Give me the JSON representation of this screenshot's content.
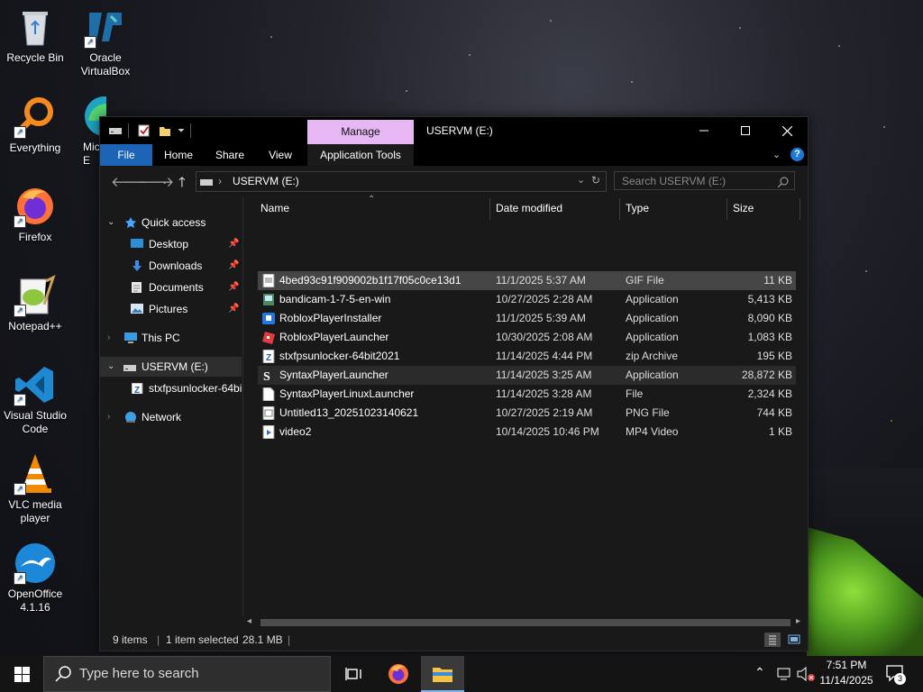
{
  "desktop": {
    "icons": [
      {
        "label": "Recycle Bin"
      },
      {
        "label": "Oracle VirtualBox"
      },
      {
        "label": "Everything"
      },
      {
        "label": "Firefox"
      },
      {
        "label": "Notepad++"
      },
      {
        "label": "Visual Studio Code"
      },
      {
        "label": "VLC media player"
      },
      {
        "label": "OpenOffice 4.1.16"
      },
      {
        "label": "Microsoft Edge (partially hidden)",
        "visible_text": "Mic E"
      }
    ]
  },
  "explorer": {
    "title": "USERVM (E:)",
    "manage_tab": "Manage",
    "ribbon_tabs": {
      "file": "File",
      "home": "Home",
      "share": "Share",
      "view": "View",
      "app_tools": "Application Tools"
    },
    "address": "USERVM (E:)",
    "search_placeholder": "Search USERVM (E:)",
    "nav": {
      "quick_access": "Quick access",
      "desktop": "Desktop",
      "downloads": "Downloads",
      "documents": "Documents",
      "pictures": "Pictures",
      "this_pc": "This PC",
      "drive": "USERVM (E:)",
      "drive_child": "stxfpsunlocker-64bi",
      "network": "Network"
    },
    "columns": {
      "name": "Name",
      "date": "Date modified",
      "type": "Type",
      "size": "Size"
    },
    "files": [
      {
        "name": "4bed93c91f909002b1f17f05c0ce13d1",
        "date": "11/1/2025 5:37 AM",
        "type": "GIF File",
        "size": "11 KB",
        "icon": "gif-file-icon"
      },
      {
        "name": "bandicam-1-7-5-en-win",
        "date": "10/27/2025 2:28 AM",
        "type": "Application",
        "size": "5,413 KB",
        "icon": "installer-icon"
      },
      {
        "name": "RobloxPlayerInstaller",
        "date": "11/1/2025 5:39 AM",
        "type": "Application",
        "size": "8,090 KB",
        "icon": "roblox-installer-icon"
      },
      {
        "name": "RobloxPlayerLauncher",
        "date": "10/30/2025 2:08 AM",
        "type": "Application",
        "size": "1,083 KB",
        "icon": "roblox-launcher-icon"
      },
      {
        "name": "stxfpsunlocker-64bit2021",
        "date": "11/14/2025 4:44 PM",
        "type": "zip Archive",
        "size": "195 KB",
        "icon": "zip-archive-icon"
      },
      {
        "name": "SyntaxPlayerLauncher",
        "date": "11/14/2025 3:25 AM",
        "type": "Application",
        "size": "28,872 KB",
        "icon": "syntax-launcher-icon"
      },
      {
        "name": "SyntaxPlayerLinuxLauncher",
        "date": "11/14/2025 3:28 AM",
        "type": "File",
        "size": "2,324 KB",
        "icon": "blank-file-icon"
      },
      {
        "name": "Untitled13_20251023140621",
        "date": "10/27/2025 2:19 AM",
        "type": "PNG File",
        "size": "744 KB",
        "icon": "png-file-icon"
      },
      {
        "name": "video2",
        "date": "10/14/2025 10:46 PM",
        "type": "MP4 Video",
        "size": "1 KB",
        "icon": "video-file-icon"
      }
    ],
    "status": {
      "items": "9 items",
      "selected": "1 item selected",
      "size": "28.1 MB"
    }
  },
  "taskbar": {
    "search_placeholder": "Type here to search",
    "time": "7:51 PM",
    "date": "11/14/2025",
    "notification_count": "3"
  },
  "colors": {
    "file_tab": "#1a63b5",
    "manage_tab": "#e6b7f2",
    "window_bg": "#191919",
    "selected_row": "#454545"
  }
}
